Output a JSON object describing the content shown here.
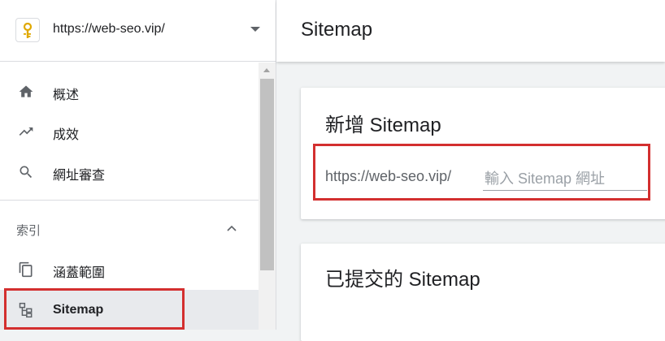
{
  "sidebar": {
    "property_url": "https://web-seo.vip/",
    "items": [
      {
        "label": "概述",
        "icon": "home-icon"
      },
      {
        "label": "成效",
        "icon": "trending-up-icon"
      },
      {
        "label": "網址審查",
        "icon": "search-icon"
      }
    ],
    "section": {
      "label": "索引",
      "items": [
        {
          "label": "涵蓋範圍",
          "icon": "copy-icon"
        },
        {
          "label": "Sitemap",
          "icon": "sitemap-icon"
        }
      ]
    }
  },
  "header": {
    "title": "Sitemap"
  },
  "add_card": {
    "title": "新增 Sitemap",
    "prefix": "https://web-seo.vip/",
    "placeholder": "輸入 Sitemap 網址",
    "value": ""
  },
  "submitted_card": {
    "title": "已提交的 Sitemap"
  },
  "colors": {
    "highlight_box": "#d32f2f",
    "active_item_bg": "#e8eaed",
    "divider": "#dadce0"
  }
}
